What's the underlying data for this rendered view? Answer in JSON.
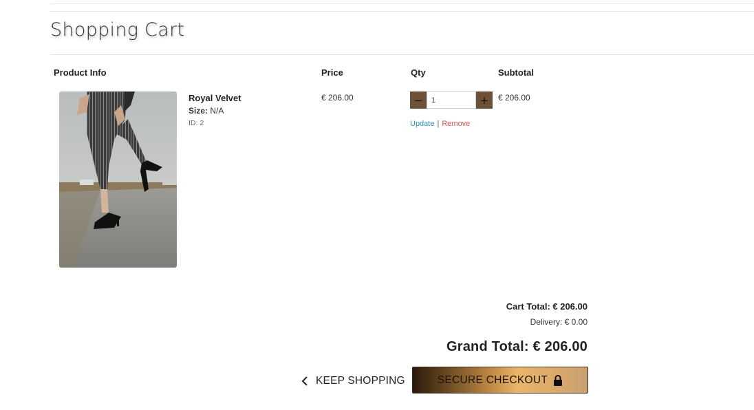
{
  "page": {
    "title": "Shopping Cart"
  },
  "table": {
    "headers": {
      "product": "Product Info",
      "price": "Price",
      "qty": "Qty",
      "subtotal": "Subtotal"
    }
  },
  "items": [
    {
      "name": "Royal Velvet",
      "size_label": "Size:",
      "size_value": "N/A",
      "id_text": "ID: 2",
      "price": "€ 206.00",
      "quantity": "1",
      "subtotal": "€ 206.00",
      "image_icon": "product-photo"
    }
  ],
  "qty_controls": {
    "decrement": "−",
    "increment": "+",
    "update": "Update",
    "separator": "|",
    "remove": "Remove"
  },
  "totals": {
    "cart_total": "Cart Total: € 206.00",
    "delivery": "Delivery: € 0.00",
    "grand_total": "Grand Total: € 206.00"
  },
  "actions": {
    "keep_shopping": "KEEP SHOPPING",
    "secure_checkout": "SECURE CHECKOUT",
    "keep_shopping_icon": "chevron-left-icon",
    "checkout_icon": "lock-icon"
  },
  "colors": {
    "qty_button": "#6b5237",
    "update_link": "#2b8fb8",
    "remove_link": "#d9534f"
  }
}
